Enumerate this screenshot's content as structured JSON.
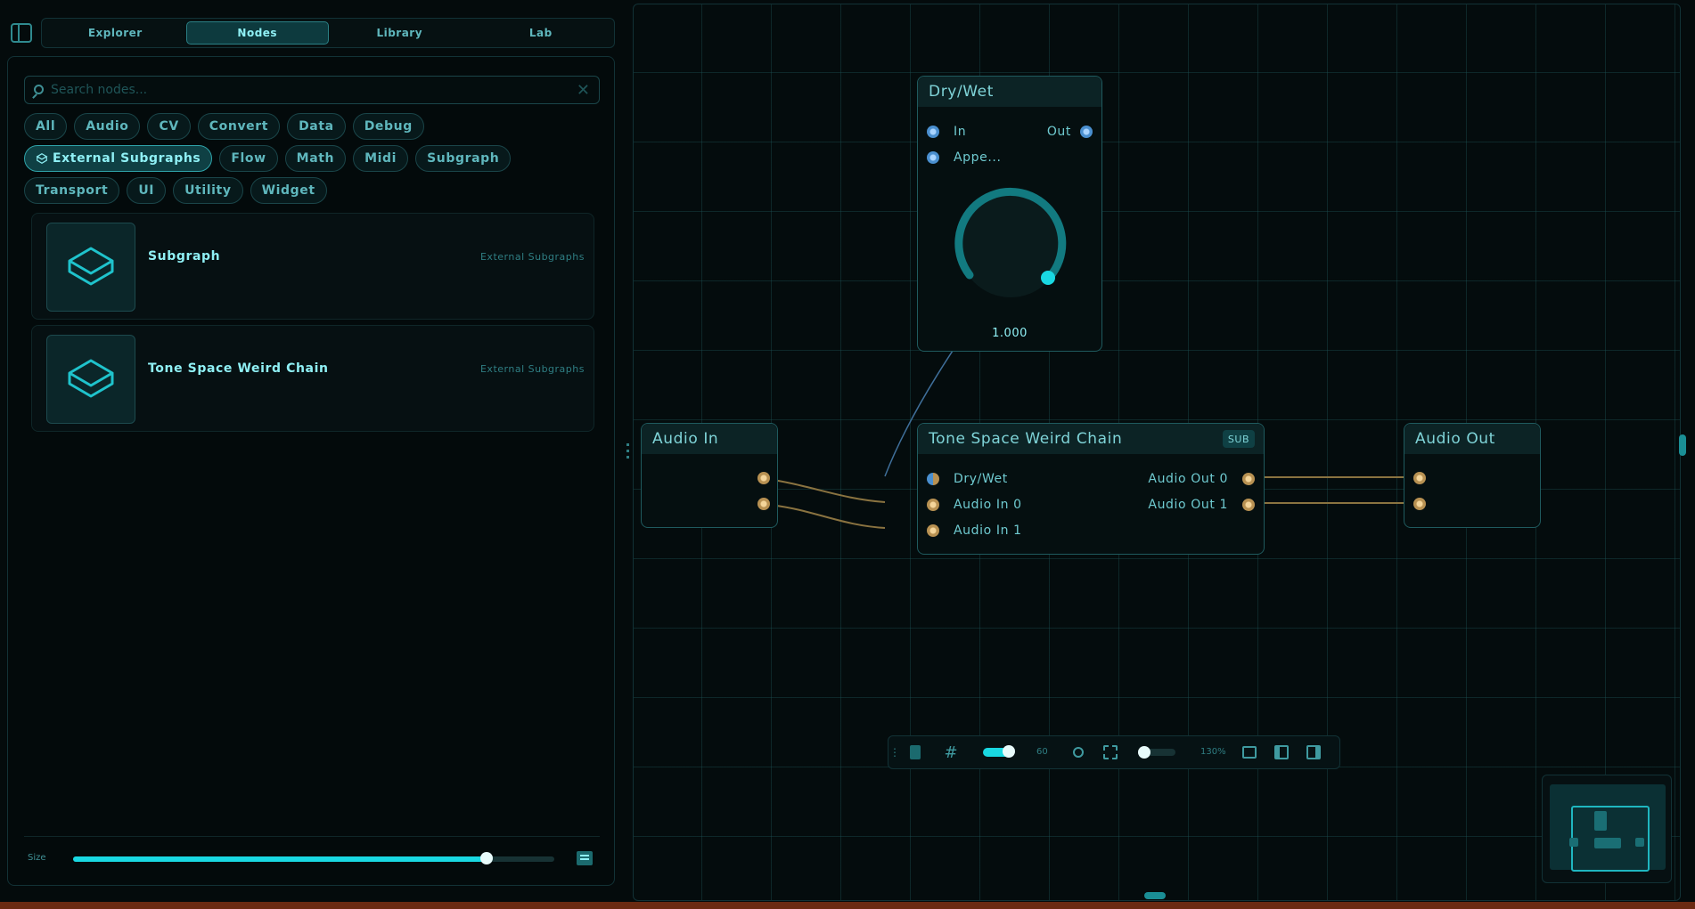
{
  "top_tabs": [
    {
      "label": "Explorer",
      "active": false
    },
    {
      "label": "Nodes",
      "active": true
    },
    {
      "label": "Library",
      "active": false
    },
    {
      "label": "Lab",
      "active": false
    }
  ],
  "search": {
    "placeholder": "Search nodes..."
  },
  "filters": [
    "All",
    "Audio",
    "CV",
    "Convert",
    "Data",
    "Debug",
    "External Subgraphs",
    "Flow",
    "Math",
    "Midi",
    "Subgraph",
    "Transport",
    "UI",
    "Utility",
    "Widget"
  ],
  "active_filter": "External Subgraphs",
  "node_list": [
    {
      "name": "Subgraph",
      "category": "External Subgraphs",
      "icon": "cube-icon"
    },
    {
      "name": "Tone Space Weird Chain",
      "category": "External Subgraphs",
      "icon": "cube-icon"
    }
  ],
  "size_slider": {
    "label": "Size",
    "value": 0.86
  },
  "graph": {
    "drywet_node": {
      "title": "Dry/Wet",
      "in_label": "In",
      "out_label": "Out",
      "append_label": "Appe...",
      "knob_value": "1.000",
      "knob_fraction": 1.0
    },
    "audio_in_node": {
      "title": "Audio In"
    },
    "chain_node": {
      "title": "Tone Space Weird Chain",
      "badge": "SUB",
      "inputs": [
        "Dry/Wet",
        "Audio In 0",
        "Audio In 1"
      ],
      "outputs": [
        "Audio Out 0",
        "Audio Out 1"
      ]
    },
    "audio_out_node": {
      "title": "Audio Out"
    }
  },
  "toolbar": {
    "fps_value": "60",
    "zoom_label": "130%",
    "snap_toggle": true
  },
  "colors": {
    "accent": "#19d8e2",
    "audio_port": "#b89152",
    "control_port": "#4a8fcf",
    "wire_audio": "#8a7340"
  }
}
